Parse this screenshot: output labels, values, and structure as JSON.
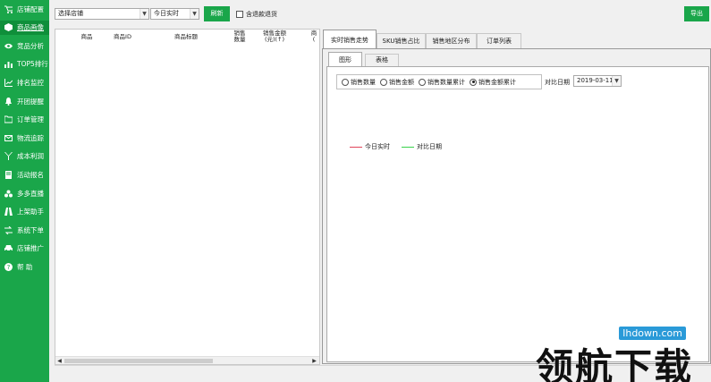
{
  "sidebar": {
    "items": [
      {
        "label": "店铺配置",
        "icon": "cart-icon",
        "active": false
      },
      {
        "label": "商品画像",
        "icon": "box-icon",
        "active": true
      },
      {
        "label": "竞品分析",
        "icon": "eye-icon",
        "active": false
      },
      {
        "label": "TOP5排行",
        "icon": "bar-chart-icon",
        "active": false
      },
      {
        "label": "排名监控",
        "icon": "line-chart-icon",
        "active": false
      },
      {
        "label": "开团提醒",
        "icon": "bell-icon",
        "active": false
      },
      {
        "label": "订单管理",
        "icon": "folder-icon",
        "active": false
      },
      {
        "label": "物流追踪",
        "icon": "mail-icon",
        "active": false
      },
      {
        "label": "成本利润",
        "icon": "yen-icon",
        "active": false
      },
      {
        "label": "活动报名",
        "icon": "book-icon",
        "active": false
      },
      {
        "label": "多多直播",
        "icon": "group-icon",
        "active": false
      },
      {
        "label": "上架助手",
        "icon": "road-icon",
        "active": false
      },
      {
        "label": "系统下单",
        "icon": "exchange-icon",
        "active": false
      },
      {
        "label": "店铺推广",
        "icon": "car-icon",
        "active": false
      },
      {
        "label": "帮 助",
        "icon": "help-icon",
        "active": false
      }
    ]
  },
  "toolbar": {
    "store_select": "选择店铺",
    "time_select": "今日实时",
    "refresh_label": "刷新",
    "include_refund_label": "含退款退货",
    "export_label": "导出"
  },
  "table": {
    "columns": [
      "商品",
      "商品ID",
      "商品标题",
      "销售\n数量",
      "销售金额\n(元)(↑)",
      "商\n("
    ]
  },
  "tabs": [
    {
      "label": "实时销售走势",
      "active": true
    },
    {
      "label": "SKU销售占比",
      "active": false
    },
    {
      "label": "销售地区分布",
      "active": false
    },
    {
      "label": "订单列表",
      "active": false
    }
  ],
  "subtabs": [
    {
      "label": "图形",
      "active": true
    },
    {
      "label": "表格",
      "active": false
    }
  ],
  "radios": [
    {
      "label": "销售数量",
      "checked": false
    },
    {
      "label": "销售金额",
      "checked": false
    },
    {
      "label": "销售数量累计",
      "checked": false
    },
    {
      "label": "销售金额累计",
      "checked": true
    }
  ],
  "compare": {
    "label": "对比日期",
    "date": "2019-03-11"
  },
  "legend": [
    {
      "label": "今日实时",
      "color": "#e0455a"
    },
    {
      "label": "对比日期",
      "color": "#39d24a"
    }
  ],
  "watermark": {
    "text": "领航下载",
    "url": "lhdown.com"
  }
}
